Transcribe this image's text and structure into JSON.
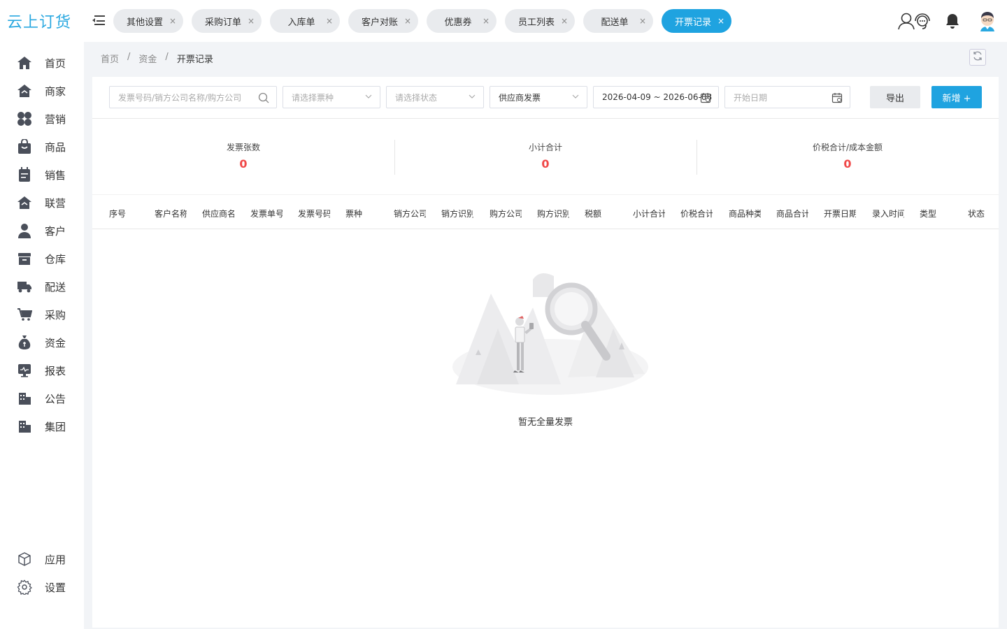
{
  "app": {
    "logo_text": "云上订货"
  },
  "tabs": [
    {
      "label": "其他设置",
      "active": false
    },
    {
      "label": "采购订单",
      "active": false
    },
    {
      "label": "入库单",
      "active": false
    },
    {
      "label": "客户对账",
      "active": false
    },
    {
      "label": "优惠券",
      "active": false
    },
    {
      "label": "员工列表",
      "active": false
    },
    {
      "label": "配送单",
      "active": false
    },
    {
      "label": "开票记录",
      "active": true
    }
  ],
  "tab_close_glyph": "×",
  "sidebar": {
    "items": [
      {
        "label": "首页",
        "icon": "home-icon"
      },
      {
        "label": "商家",
        "icon": "store-icon"
      },
      {
        "label": "营销",
        "icon": "clover-icon"
      },
      {
        "label": "商品",
        "icon": "bag-icon"
      },
      {
        "label": "销售",
        "icon": "calendar-icon"
      },
      {
        "label": "联营",
        "icon": "store-link-icon"
      },
      {
        "label": "客户",
        "icon": "user-icon"
      },
      {
        "label": "仓库",
        "icon": "box-icon"
      },
      {
        "label": "配送",
        "icon": "truck-icon"
      },
      {
        "label": "采购",
        "icon": "cart-icon"
      },
      {
        "label": "资金",
        "icon": "money-bag-icon"
      },
      {
        "label": "报表",
        "icon": "monitor-icon"
      },
      {
        "label": "公告",
        "icon": "building-icon"
      },
      {
        "label": "集团",
        "icon": "group-building-icon"
      }
    ],
    "bottom": [
      {
        "label": "应用",
        "icon": "cube-icon"
      },
      {
        "label": "设置",
        "icon": "gear-icon"
      }
    ]
  },
  "breadcrumb": {
    "items": [
      "首页",
      "资金",
      "开票记录"
    ],
    "separator": "/"
  },
  "filters": {
    "search_placeholder": "发票号码/销方公司名称/购方公司",
    "ticket_type_placeholder": "请选择票种",
    "status_placeholder": "请选择状态",
    "invoice_source": "供应商发票",
    "date_range": "2026-04-09 ~ 2026-06-08",
    "start_date_placeholder": "开始日期",
    "export_label": "导出",
    "add_label": "新增 +"
  },
  "stats": [
    {
      "label": "发票张数",
      "value": "0"
    },
    {
      "label": "小计合计",
      "value": "0"
    },
    {
      "label": "价税合计/成本金额",
      "value": "0"
    }
  ],
  "table": {
    "columns": [
      "序号",
      "客户名称",
      "供应商名",
      "发票单号",
      "发票号码",
      "票种",
      "销方公司",
      "销方识别",
      "购方公司",
      "购方识别",
      "税额",
      "小计合计",
      "价税合计",
      "商品种类",
      "商品合计",
      "开票日期",
      "录入时间",
      "类型",
      "状态"
    ],
    "empty_text": "暂无全量发票"
  },
  "colors": {
    "accent": "#1fa3e0",
    "danger": "#f04848"
  }
}
